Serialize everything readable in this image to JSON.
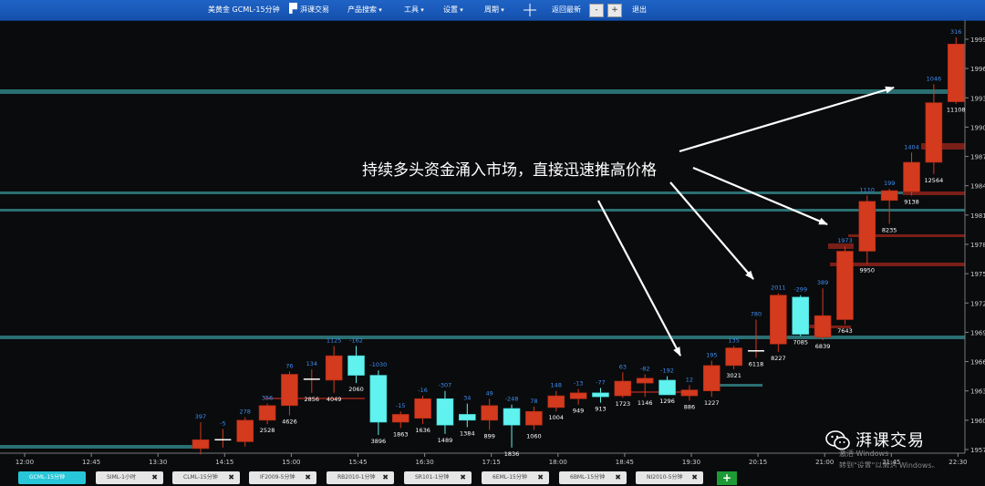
{
  "toolbar": {
    "title": "美黄金 GCML-15分钟",
    "logo_text": "湃课交易",
    "menu_products": "产品搜索",
    "menu_tools": "工具",
    "menu_settings": "设置",
    "menu_period": "周期",
    "crosshair_icon": "crosshair-icon",
    "back_latest": "返回最新",
    "zoom_out": "-",
    "zoom_in": "+",
    "exit": "退出"
  },
  "annotation": "持续多头资金涌入市场，直接迅速推高价格",
  "watermark": {
    "text": "湃课交易",
    "icon": "wechat-icon",
    "activate_line1": "激活 Windows",
    "activate_line2": "转到\"设置\"以激活 Windows。"
  },
  "tabs": [
    {
      "label": "GCML-15分钟",
      "active": true
    },
    {
      "label": "SIML-1小时",
      "active": false
    },
    {
      "label": "CLML-15分钟",
      "active": false
    },
    {
      "label": "IF2009-5分钟",
      "active": false
    },
    {
      "label": "RB2010-1分钟",
      "active": false
    },
    {
      "label": "SR101-1分钟",
      "active": false
    },
    {
      "label": "6EML-15分钟",
      "active": false
    },
    {
      "label": "6BML-15分钟",
      "active": false
    },
    {
      "label": "NI2010-5分钟",
      "active": false
    }
  ],
  "add_tab": "+",
  "colors": {
    "up": "#d33a1e",
    "down": "#5ff2ee",
    "background": "#0a0b0d",
    "support_line": "#2a6f72",
    "resistance_line": "#7a1f17",
    "top_label": "#3d8ef0",
    "bottom_label": "#ffffff",
    "arrow": "#ffffff"
  },
  "chart_data": {
    "type": "candlestick",
    "y_ticks": [
      "1999",
      "1996",
      "1993",
      "1990",
      "1987",
      "1984",
      "1981",
      "1978",
      "1975",
      "1972",
      "1969",
      "1966",
      "1963",
      "1960",
      "1957"
    ],
    "x_ticks": [
      "12:00",
      "12:45",
      "13:30",
      "14:15",
      "15:00",
      "15:45",
      "16:30",
      "17:15",
      "18:00",
      "18:45",
      "19:30",
      "20:15",
      "21:00",
      "21:45",
      "22:30"
    ],
    "candles": [
      {
        "o": 1957.1,
        "h": 1959.8,
        "l": 1956.5,
        "c": 1958.0,
        "top": "397",
        "bot": ""
      },
      {
        "o": 1958.0,
        "h": 1959.1,
        "l": 1957.2,
        "c": 1958.0,
        "top": "-5",
        "bot": ""
      },
      {
        "o": 1957.8,
        "h": 1960.3,
        "l": 1957.3,
        "c": 1960.0,
        "top": "278",
        "bot": ""
      },
      {
        "o": 1960.0,
        "h": 1961.7,
        "l": 1959.6,
        "c": 1961.5,
        "top": "356",
        "bot": "2528"
      },
      {
        "o": 1961.5,
        "h": 1965.0,
        "l": 1960.5,
        "c": 1964.7,
        "top": "76",
        "bot": "4626"
      },
      {
        "o": 1964.2,
        "h": 1965.2,
        "l": 1962.8,
        "c": 1964.2,
        "top": "134",
        "bot": "2856"
      },
      {
        "o": 1964.1,
        "h": 1967.6,
        "l": 1962.8,
        "c": 1966.6,
        "top": "1125",
        "bot": "4049"
      },
      {
        "o": 1966.6,
        "h": 1967.6,
        "l": 1963.8,
        "c": 1964.6,
        "top": "-162",
        "bot": "2060"
      },
      {
        "o": 1964.6,
        "h": 1965.1,
        "l": 1958.5,
        "c": 1959.8,
        "top": "-1030",
        "bot": "3896"
      },
      {
        "o": 1959.8,
        "h": 1960.9,
        "l": 1959.2,
        "c": 1960.6,
        "top": "-15",
        "bot": "1863"
      },
      {
        "o": 1960.2,
        "h": 1962.5,
        "l": 1959.6,
        "c": 1962.2,
        "top": "-16",
        "bot": "1636"
      },
      {
        "o": 1962.2,
        "h": 1963.0,
        "l": 1958.6,
        "c": 1959.5,
        "top": "-307",
        "bot": "1489"
      },
      {
        "o": 1960.6,
        "h": 1961.7,
        "l": 1959.3,
        "c": 1960.0,
        "top": "34",
        "bot": "1384"
      },
      {
        "o": 1960.0,
        "h": 1962.2,
        "l": 1959.0,
        "c": 1961.5,
        "top": "49",
        "bot": "899"
      },
      {
        "o": 1961.2,
        "h": 1961.6,
        "l": 1957.2,
        "c": 1959.5,
        "top": "-248",
        "bot": "1836"
      },
      {
        "o": 1959.5,
        "h": 1961.4,
        "l": 1959.0,
        "c": 1960.9,
        "top": "78",
        "bot": "1060"
      },
      {
        "o": 1961.3,
        "h": 1963.0,
        "l": 1960.9,
        "c": 1962.5,
        "top": "148",
        "bot": "1004"
      },
      {
        "o": 1962.2,
        "h": 1963.2,
        "l": 1961.6,
        "c": 1962.8,
        "top": "-13",
        "bot": "949"
      },
      {
        "o": 1962.8,
        "h": 1963.3,
        "l": 1961.8,
        "c": 1962.4,
        "top": "-77",
        "bot": "913"
      },
      {
        "o": 1962.5,
        "h": 1964.9,
        "l": 1962.3,
        "c": 1964.0,
        "top": "63",
        "bot": "1723"
      },
      {
        "o": 1963.8,
        "h": 1964.7,
        "l": 1962.4,
        "c": 1964.3,
        "top": "-82",
        "bot": "1146"
      },
      {
        "o": 1964.1,
        "h": 1964.5,
        "l": 1962.6,
        "c": 1962.6,
        "top": "-192",
        "bot": "1296"
      },
      {
        "o": 1962.5,
        "h": 1963.6,
        "l": 1962.0,
        "c": 1963.1,
        "top": "12",
        "bot": "886"
      },
      {
        "o": 1963.0,
        "h": 1966.1,
        "l": 1962.4,
        "c": 1965.6,
        "top": "195",
        "bot": "1227"
      },
      {
        "o": 1965.6,
        "h": 1967.6,
        "l": 1965.2,
        "c": 1967.4,
        "top": "135",
        "bot": "3021"
      },
      {
        "o": 1967.1,
        "h": 1970.3,
        "l": 1966.4,
        "c": 1967.1,
        "top": "780",
        "bot": "6118"
      },
      {
        "o": 1967.8,
        "h": 1973.0,
        "l": 1967.0,
        "c": 1972.8,
        "top": "2011",
        "bot": "8227"
      },
      {
        "o": 1972.6,
        "h": 1972.8,
        "l": 1968.6,
        "c": 1968.8,
        "top": "-299",
        "bot": "7085"
      },
      {
        "o": 1968.5,
        "h": 1973.5,
        "l": 1968.2,
        "c": 1970.7,
        "top": "389",
        "bot": "6839"
      },
      {
        "o": 1970.3,
        "h": 1977.8,
        "l": 1969.8,
        "c": 1977.3,
        "top": "1973",
        "bot": "7643"
      },
      {
        "o": 1977.3,
        "h": 1983.0,
        "l": 1976.0,
        "c": 1982.4,
        "top": "1110",
        "bot": "9950"
      },
      {
        "o": 1982.5,
        "h": 1983.7,
        "l": 1980.1,
        "c": 1983.5,
        "top": "199",
        "bot": "8235"
      },
      {
        "o": 1983.4,
        "h": 1987.4,
        "l": 1983.0,
        "c": 1986.4,
        "top": "1404",
        "bot": "9138"
      },
      {
        "o": 1986.4,
        "h": 1994.4,
        "l": 1985.2,
        "c": 1992.5,
        "top": "1046",
        "bot": "12564"
      },
      {
        "o": 1992.6,
        "h": 1999.2,
        "l": 1992.4,
        "c": 1998.5,
        "top": "316",
        "bot": "11108"
      }
    ]
  }
}
